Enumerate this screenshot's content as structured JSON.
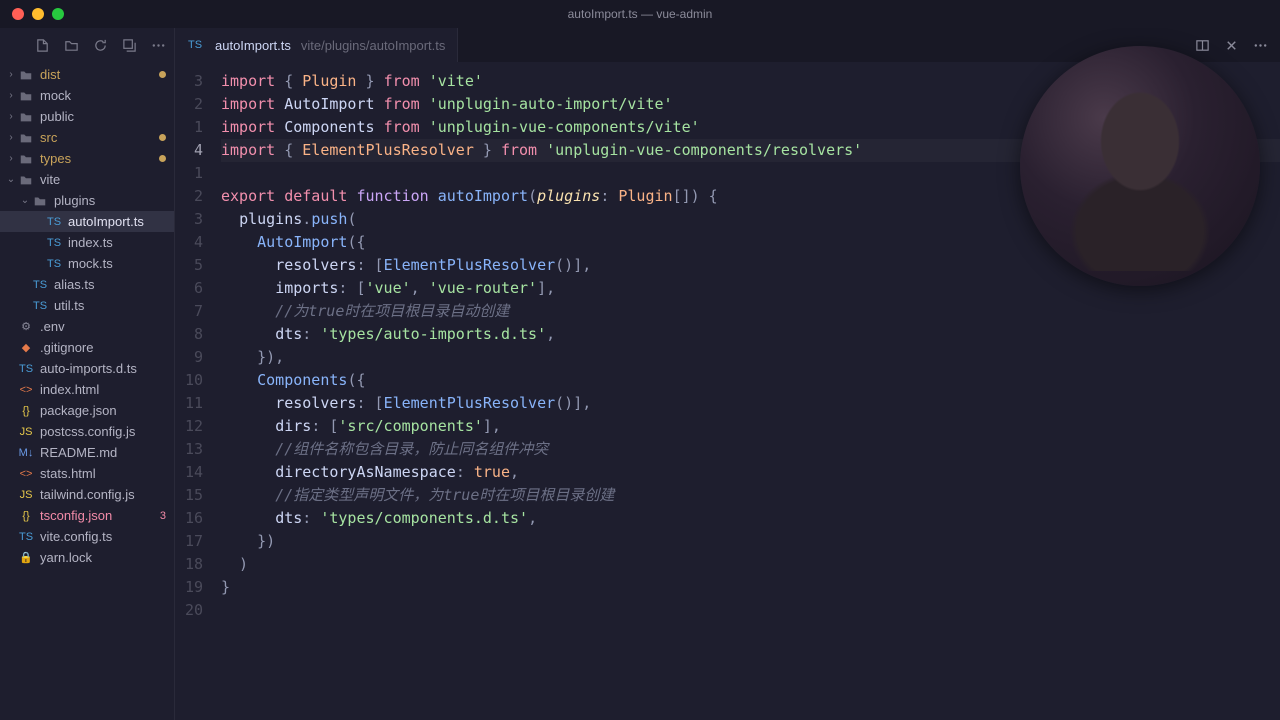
{
  "window": {
    "title": "autoImport.ts — vue-admin"
  },
  "sidebar": {
    "tree": [
      {
        "depth": 0,
        "chev": "›",
        "icon": "folder",
        "label": "dist",
        "modified": true,
        "dot": true
      },
      {
        "depth": 0,
        "chev": "›",
        "icon": "folder",
        "label": "mock"
      },
      {
        "depth": 0,
        "chev": "›",
        "icon": "folder",
        "label": "public"
      },
      {
        "depth": 0,
        "chev": "›",
        "icon": "folder",
        "label": "src",
        "modified": true,
        "dot": true
      },
      {
        "depth": 0,
        "chev": "›",
        "icon": "folder",
        "label": "types",
        "modified": true,
        "dot": true
      },
      {
        "depth": 0,
        "chev": "⌄",
        "icon": "folder",
        "label": "vite"
      },
      {
        "depth": 1,
        "chev": "⌄",
        "icon": "folder",
        "label": "plugins"
      },
      {
        "depth": 2,
        "chev": "",
        "icon": "ts",
        "label": "autoImport.ts",
        "active": true
      },
      {
        "depth": 2,
        "chev": "",
        "icon": "ts",
        "label": "index.ts"
      },
      {
        "depth": 2,
        "chev": "",
        "icon": "ts",
        "label": "mock.ts"
      },
      {
        "depth": 1,
        "chev": "",
        "icon": "ts",
        "label": "alias.ts"
      },
      {
        "depth": 1,
        "chev": "",
        "icon": "ts",
        "label": "util.ts"
      },
      {
        "depth": 0,
        "chev": "",
        "icon": "env",
        "label": ".env"
      },
      {
        "depth": 0,
        "chev": "",
        "icon": "git",
        "label": ".gitignore"
      },
      {
        "depth": 0,
        "chev": "",
        "icon": "ts",
        "label": "auto-imports.d.ts"
      },
      {
        "depth": 0,
        "chev": "",
        "icon": "html",
        "label": "index.html"
      },
      {
        "depth": 0,
        "chev": "",
        "icon": "json",
        "label": "package.json"
      },
      {
        "depth": 0,
        "chev": "",
        "icon": "js",
        "label": "postcss.config.js"
      },
      {
        "depth": 0,
        "chev": "",
        "icon": "md",
        "label": "README.md"
      },
      {
        "depth": 0,
        "chev": "",
        "icon": "html",
        "label": "stats.html"
      },
      {
        "depth": 0,
        "chev": "",
        "icon": "js",
        "label": "tailwind.config.js"
      },
      {
        "depth": 0,
        "chev": "",
        "icon": "json",
        "label": "tsconfig.json",
        "error": true,
        "badge": "3"
      },
      {
        "depth": 0,
        "chev": "",
        "icon": "ts",
        "label": "vite.config.ts"
      },
      {
        "depth": 0,
        "chev": "",
        "icon": "lock",
        "label": "yarn.lock"
      }
    ]
  },
  "tab": {
    "icon": "ts",
    "filename": "autoImport.ts",
    "path": "vite/plugins/autoImport.ts"
  },
  "gutter": [
    "3",
    "2",
    "1",
    "4",
    "1",
    "2",
    "3",
    "4",
    "5",
    "6",
    "7",
    "8",
    "9",
    "10",
    "11",
    "12",
    "13",
    "14",
    "15",
    "16",
    "17",
    "18",
    "19",
    "20"
  ],
  "active_gutter_index": 3,
  "code": {
    "l0": [
      [
        "kw",
        "import"
      ],
      [
        "punc",
        " { "
      ],
      [
        "type",
        "Plugin"
      ],
      [
        "punc",
        " } "
      ],
      [
        "kw",
        "from"
      ],
      [
        "punc",
        " "
      ],
      [
        "str",
        "'vite'"
      ]
    ],
    "l1": [
      [
        "kw",
        "import"
      ],
      [
        "ident",
        " AutoImport "
      ],
      [
        "kw",
        "from"
      ],
      [
        "punc",
        " "
      ],
      [
        "str",
        "'unplugin-auto-import/vite'"
      ]
    ],
    "l2": [
      [
        "kw",
        "import"
      ],
      [
        "ident",
        " Components "
      ],
      [
        "kw",
        "from"
      ],
      [
        "punc",
        " "
      ],
      [
        "str",
        "'unplugin-vue-components/vite'"
      ]
    ],
    "l3": [
      [
        "kw",
        "import"
      ],
      [
        "punc",
        " { "
      ],
      [
        "type",
        "ElementPlusResolver"
      ],
      [
        "punc",
        " } "
      ],
      [
        "kw",
        "from"
      ],
      [
        "punc",
        " "
      ],
      [
        "str",
        "'unplugin-vue-components/resolvers'"
      ]
    ],
    "l4": [],
    "l5": [
      [
        "kw",
        "export"
      ],
      [
        "punc",
        " "
      ],
      [
        "kw",
        "default"
      ],
      [
        "punc",
        " "
      ],
      [
        "kw2",
        "function"
      ],
      [
        "punc",
        " "
      ],
      [
        "fn",
        "autoImport"
      ],
      [
        "punc",
        "("
      ],
      [
        "param",
        "plugins"
      ],
      [
        "punc",
        ": "
      ],
      [
        "type",
        "Plugin"
      ],
      [
        "punc",
        "[]) {"
      ]
    ],
    "l6": [
      [
        "punc",
        "  "
      ],
      [
        "ident",
        "plugins"
      ],
      [
        "punc",
        "."
      ],
      [
        "fn",
        "push"
      ],
      [
        "punc",
        "("
      ]
    ],
    "l7": [
      [
        "punc",
        "    "
      ],
      [
        "fn",
        "AutoImport"
      ],
      [
        "punc",
        "({"
      ]
    ],
    "l8": [
      [
        "punc",
        "      "
      ],
      [
        "prop",
        "resolvers"
      ],
      [
        "punc",
        ": ["
      ],
      [
        "fn",
        "ElementPlusResolver"
      ],
      [
        "punc",
        "()],"
      ]
    ],
    "l9": [
      [
        "punc",
        "      "
      ],
      [
        "prop",
        "imports"
      ],
      [
        "punc",
        ": ["
      ],
      [
        "str",
        "'vue'"
      ],
      [
        "punc",
        ", "
      ],
      [
        "str",
        "'vue-router'"
      ],
      [
        "punc",
        "],"
      ]
    ],
    "l10": [
      [
        "punc",
        "      "
      ],
      [
        "comment",
        "//为true时在项目根目录自动创建"
      ]
    ],
    "l11": [
      [
        "punc",
        "      "
      ],
      [
        "prop",
        "dts"
      ],
      [
        "punc",
        ": "
      ],
      [
        "str",
        "'types/auto-imports.d.ts'"
      ],
      [
        "punc",
        ","
      ]
    ],
    "l12": [
      [
        "punc",
        "    }),"
      ]
    ],
    "l13": [
      [
        "punc",
        "    "
      ],
      [
        "fn",
        "Components"
      ],
      [
        "punc",
        "({"
      ]
    ],
    "l14": [
      [
        "punc",
        "      "
      ],
      [
        "prop",
        "resolvers"
      ],
      [
        "punc",
        ": ["
      ],
      [
        "fn",
        "ElementPlusResolver"
      ],
      [
        "punc",
        "()],"
      ]
    ],
    "l15": [
      [
        "punc",
        "      "
      ],
      [
        "prop",
        "dirs"
      ],
      [
        "punc",
        ": ["
      ],
      [
        "str",
        "'src/components'"
      ],
      [
        "punc",
        "],"
      ]
    ],
    "l16": [
      [
        "punc",
        "      "
      ],
      [
        "comment",
        "//组件名称包含目录，防止同名组件冲突"
      ]
    ],
    "l17": [
      [
        "punc",
        "      "
      ],
      [
        "prop",
        "directoryAsNamespace"
      ],
      [
        "punc",
        ": "
      ],
      [
        "bool",
        "true"
      ],
      [
        "punc",
        ","
      ]
    ],
    "l18": [
      [
        "punc",
        "      "
      ],
      [
        "comment",
        "//指定类型声明文件，为true时在项目根目录创建"
      ]
    ],
    "l19": [
      [
        "punc",
        "      "
      ],
      [
        "prop",
        "dts"
      ],
      [
        "punc",
        ": "
      ],
      [
        "str",
        "'types/components.d.ts'"
      ],
      [
        "punc",
        ","
      ]
    ],
    "l20": [
      [
        "punc",
        "    })"
      ]
    ],
    "l21": [
      [
        "punc",
        "  )"
      ]
    ],
    "l22": [
      [
        "punc",
        "}"
      ]
    ],
    "l23": []
  }
}
